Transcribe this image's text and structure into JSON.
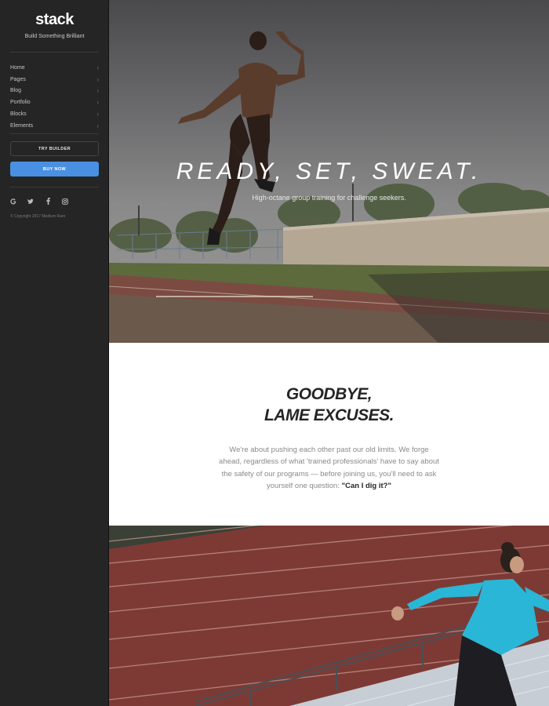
{
  "sidebar": {
    "logo": "stack",
    "tagline": "Build Something Brilliant",
    "nav": [
      {
        "label": "Home"
      },
      {
        "label": "Pages"
      },
      {
        "label": "Blog"
      },
      {
        "label": "Portfolio"
      },
      {
        "label": "Blocks"
      },
      {
        "label": "Elements"
      }
    ],
    "try_builder": "TRY BUILDER",
    "buy_now": "BUY NOW",
    "socials": [
      "google-icon",
      "twitter-icon",
      "facebook-icon",
      "instagram-icon"
    ],
    "copyright": "© Copyright 2017 Medium Rare"
  },
  "hero": {
    "title": "READY, SET, SWEAT.",
    "subtitle": "High-octane group training for challenge seekers."
  },
  "intro": {
    "heading_line1": "GOODBYE,",
    "heading_line2": "LAME EXCUSES.",
    "body": "We're about pushing each other past our old limits. We forge ahead, regardless of what 'trained professionals' have to say about the safety of our programs — before joining us, you'll need to ask yourself one question: ",
    "body_emphasis": "\"Can I dig it?\""
  },
  "colors": {
    "sidebar_bg": "#252525",
    "accent_blue": "#4a90e2",
    "heading_text": "#252525",
    "body_text": "#8a8a8a"
  }
}
